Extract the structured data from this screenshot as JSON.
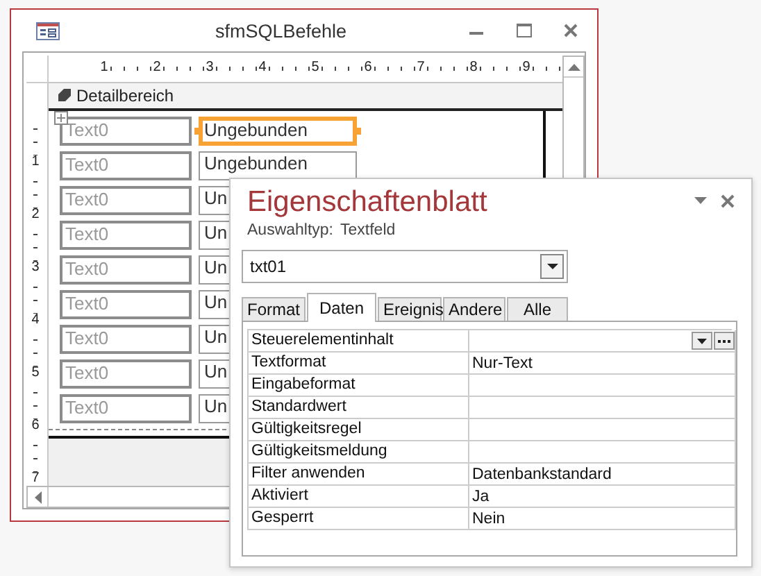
{
  "form_window": {
    "title": "sfmSQLBefehle",
    "ruler": {
      "horizontal": [
        "1",
        "2",
        "3",
        "4",
        "5",
        "6",
        "7",
        "8",
        "9"
      ],
      "vertical": [
        "1",
        "2",
        "3",
        "4",
        "5",
        "6",
        "7"
      ]
    },
    "section": {
      "title": "Detailbereich"
    },
    "rows": [
      {
        "label": "Text0",
        "field": "Ungebunden",
        "selected": true
      },
      {
        "label": "Text0",
        "field": "Ungebunden",
        "selected": false
      },
      {
        "label": "Text0",
        "field": "Un",
        "selected": false
      },
      {
        "label": "Text0",
        "field": "Un",
        "selected": false
      },
      {
        "label": "Text0",
        "field": "Un",
        "selected": false
      },
      {
        "label": "Text0",
        "field": "Un",
        "selected": false
      },
      {
        "label": "Text0",
        "field": "Un",
        "selected": false
      },
      {
        "label": "Text0",
        "field": "Un",
        "selected": false
      },
      {
        "label": "Text0",
        "field": "Un",
        "selected": false
      }
    ]
  },
  "property_sheet": {
    "title": "Eigenschaftenblatt",
    "selection_type_label": "Auswahltyp:",
    "selection_type": "Textfeld",
    "object": "txt01",
    "tabs": [
      {
        "label": "Format",
        "selected": false
      },
      {
        "label": "Daten",
        "selected": true
      },
      {
        "label": "Ereignis",
        "selected": false
      },
      {
        "label": "Andere",
        "selected": false
      },
      {
        "label": "Alle",
        "selected": false
      }
    ],
    "properties": [
      {
        "name": "Steuerelementinhalt",
        "kind": "builder"
      },
      {
        "name": "Textformat",
        "value": "Nur-Text",
        "kind": "text"
      },
      {
        "name": "Eingabeformat",
        "kind": "text"
      },
      {
        "name": "Standardwert",
        "kind": "text"
      },
      {
        "name": "Gültigkeitsregel",
        "kind": "text"
      },
      {
        "name": "Gültigkeitsmeldung",
        "kind": "text"
      },
      {
        "name": "Filter anwenden",
        "value": "Datenbankstandard",
        "kind": "text"
      },
      {
        "name": "Aktiviert",
        "value": "Ja",
        "kind": "text"
      },
      {
        "name": "Gesperrt",
        "value": "Nein",
        "kind": "text"
      }
    ]
  }
}
